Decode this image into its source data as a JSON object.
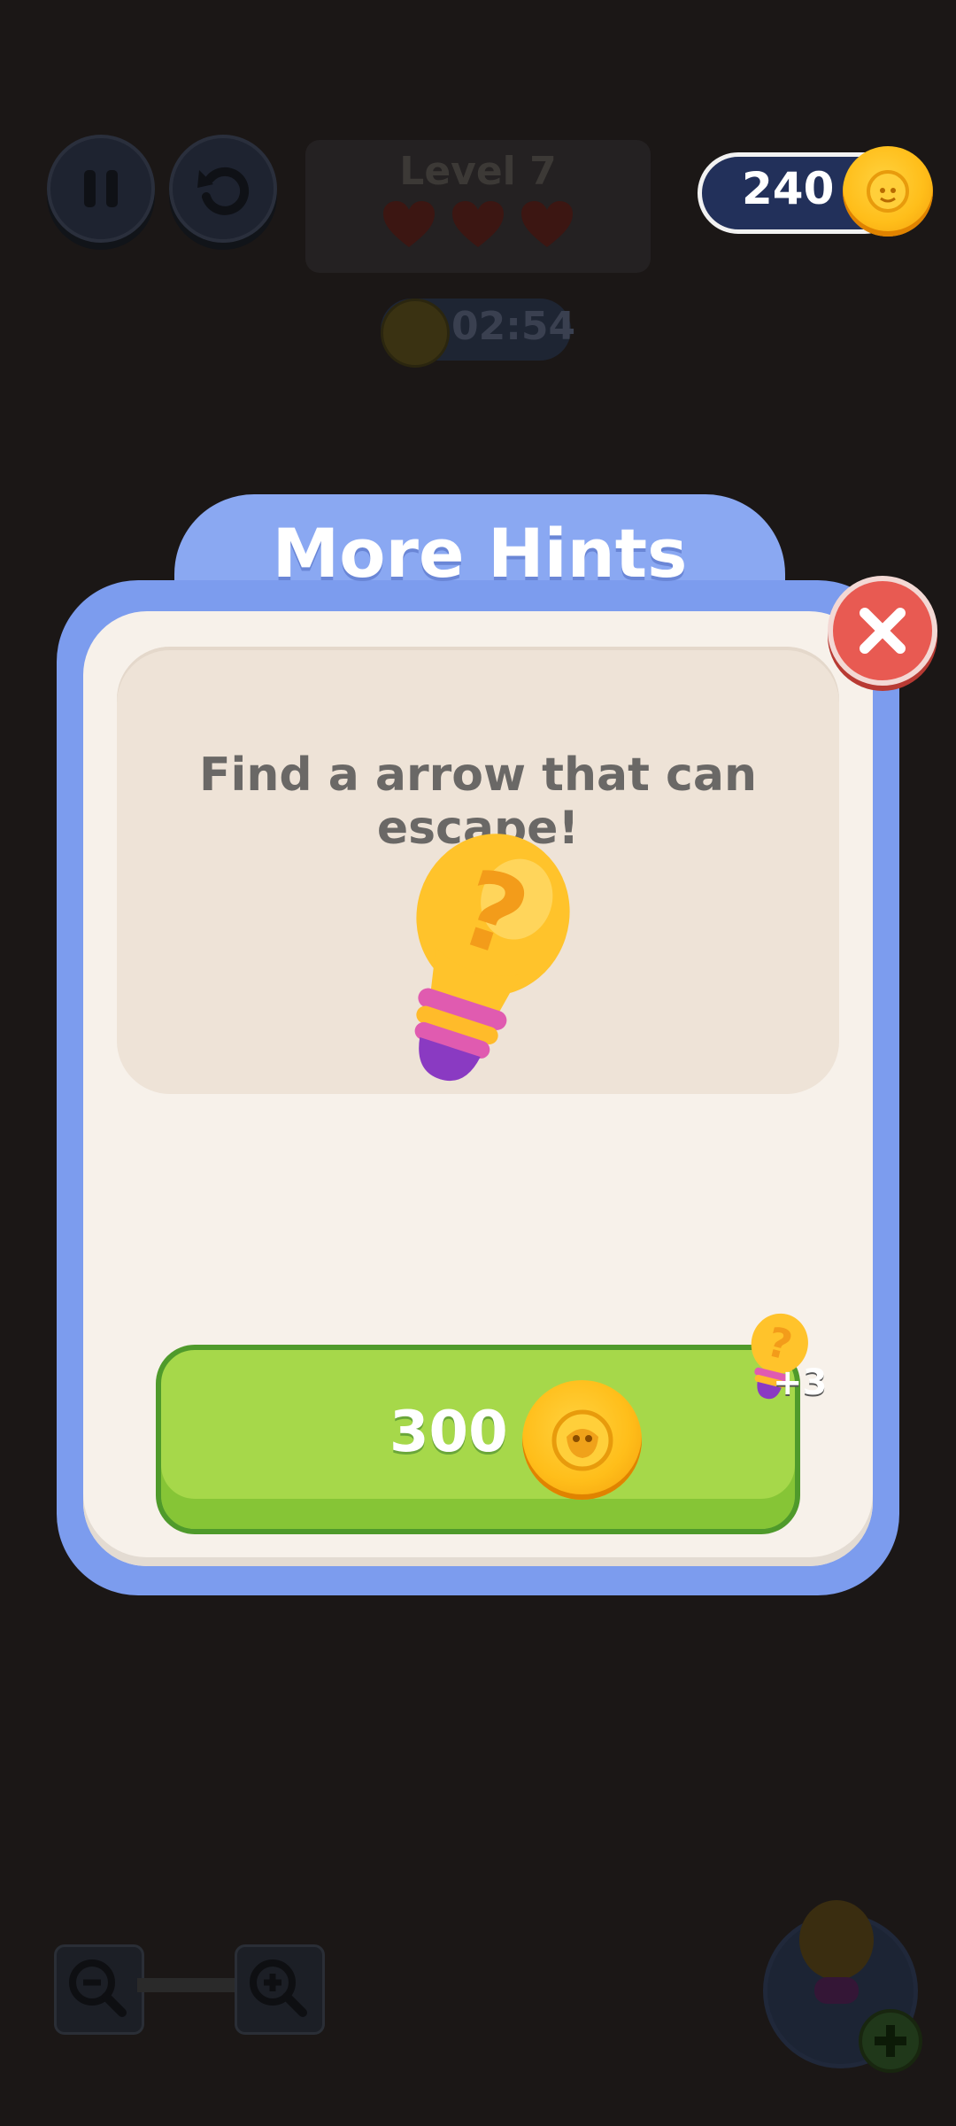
{
  "hud": {
    "level_label": "Level 7",
    "timer": "02:54",
    "coins": "240",
    "hearts": 3
  },
  "modal": {
    "title": "More Hints",
    "hint_text": "Find a arrow that can escape!",
    "buy_price": "300",
    "reward": "+3"
  },
  "icons": {
    "pause": "pause-icon",
    "undo": "undo-icon",
    "close": "close-icon",
    "coin": "coin-icon",
    "hint": "lightbulb-question-icon",
    "zoom_out": "zoom-out-icon",
    "zoom_in": "zoom-in-icon"
  },
  "colors": {
    "modal_blue": "#7c9cee",
    "panel_cream": "#f7f1ea",
    "buy_green": "#a6d84a",
    "close_red": "#e85a52",
    "coin_gold": "#ffbe1a"
  }
}
